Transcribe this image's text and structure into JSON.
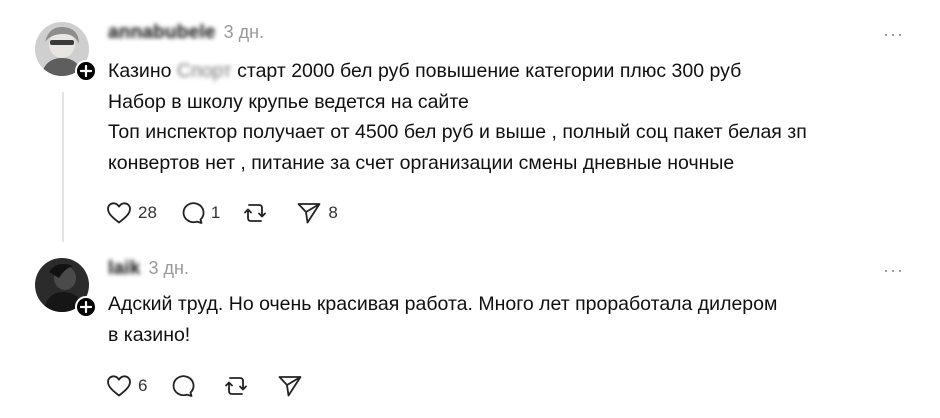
{
  "posts": [
    {
      "username": "annabubele",
      "time": "3 дн.",
      "more": "···",
      "lines": [
        "Казино",
        "старт 2000 бел руб повышение категории плюс 300 руб",
        "Набор в школу крупье ведется на сайте",
        "Топ инспектор получает от 4500 бел руб и выше , полный соц пакет белая зп",
        "конвертов нет , питание за счет организации смены дневные ночные"
      ],
      "redacted": "Спорт",
      "likes": "28",
      "replies": "1",
      "reposts": "",
      "shares": "8",
      "icons": [
        "heart-icon",
        "comment-icon",
        "repost-icon",
        "share-icon"
      ]
    },
    {
      "username": "laik",
      "time": "3 дн.",
      "more": "···",
      "lines": [
        "Адский труд. Но очень красивая работа. Много лет проработала дилером",
        "в казино!"
      ],
      "likes": "6",
      "replies": "",
      "reposts": "",
      "shares": ""
    }
  ]
}
